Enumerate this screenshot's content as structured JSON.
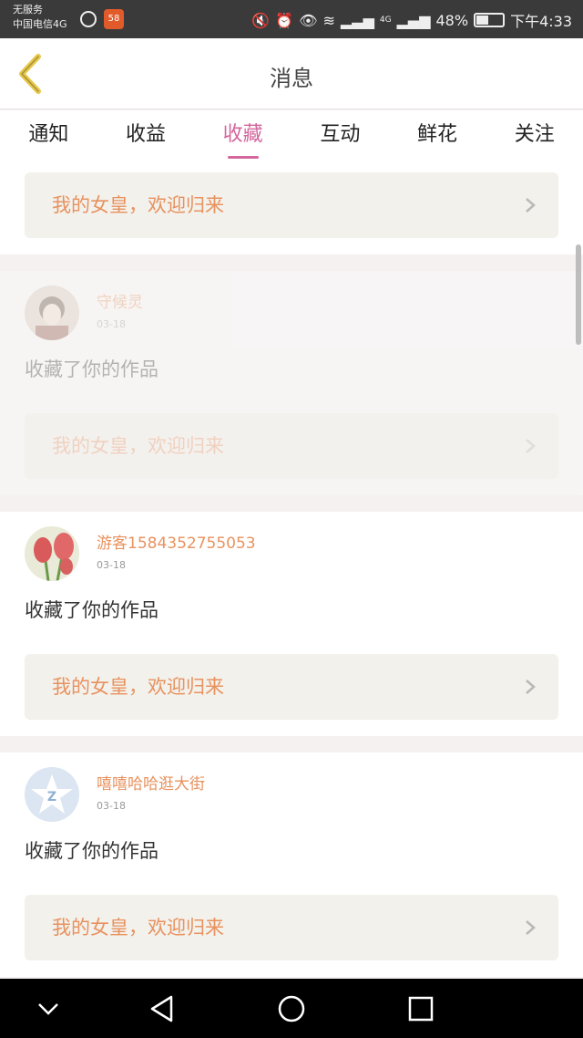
{
  "status_bar": {
    "carrier_line1": "无服务",
    "carrier_line2": "中国电信4G",
    "network": "4G",
    "battery": "48%",
    "battery_level": 0.48,
    "time": "下午4:33"
  },
  "header": {
    "title": "消息"
  },
  "tabs": [
    {
      "label": "通知",
      "active": false
    },
    {
      "label": "收益",
      "active": false
    },
    {
      "label": "收藏",
      "active": true
    },
    {
      "label": "互动",
      "active": false
    },
    {
      "label": "鲜花",
      "active": false
    },
    {
      "label": "关注",
      "active": false
    }
  ],
  "top_banner": {
    "text": "我的女皇，欢迎归来"
  },
  "items": [
    {
      "username": "守候灵",
      "date": "03-18",
      "message": "收藏了你的作品",
      "banner": "我的女皇，欢迎归来"
    },
    {
      "username": "游客1584352755053",
      "date": "03-18",
      "message": "收藏了你的作品",
      "banner": "我的女皇，欢迎归来"
    },
    {
      "username": "嘻嘻哈哈逛大街",
      "date": "03-18",
      "message": "收藏了你的作品",
      "banner": "我的女皇，欢迎归来"
    }
  ],
  "colors": {
    "accent": "#d4679d",
    "orange": "#e8925f",
    "back_arrow": "#e6c84a"
  }
}
